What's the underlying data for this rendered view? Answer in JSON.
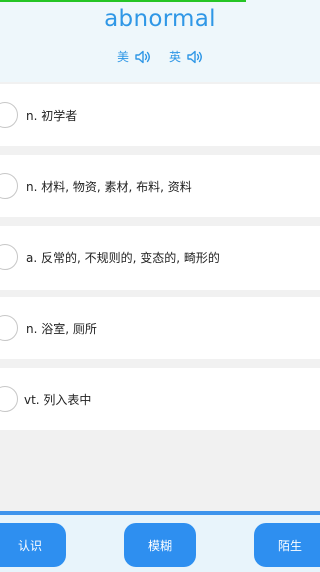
{
  "word": "abnormal",
  "progress": 0.77,
  "pronunciation": {
    "us_label": "美",
    "uk_label": "英"
  },
  "options": [
    {
      "text": "n. 初学者"
    },
    {
      "text": "n. 材料, 物资, 素材, 布料, 资料"
    },
    {
      "text": "a. 反常的, 不规则的, 变态的, 畸形的"
    },
    {
      "text": "n. 浴室, 厕所"
    },
    {
      "text": "vt. 列入表中"
    }
  ],
  "buttons": {
    "know": "认识",
    "vague": "模糊",
    "unknown": "陌生"
  },
  "colors": {
    "accent": "#2f97e6",
    "button": "#2e8ff0",
    "progress": "#25c525"
  }
}
